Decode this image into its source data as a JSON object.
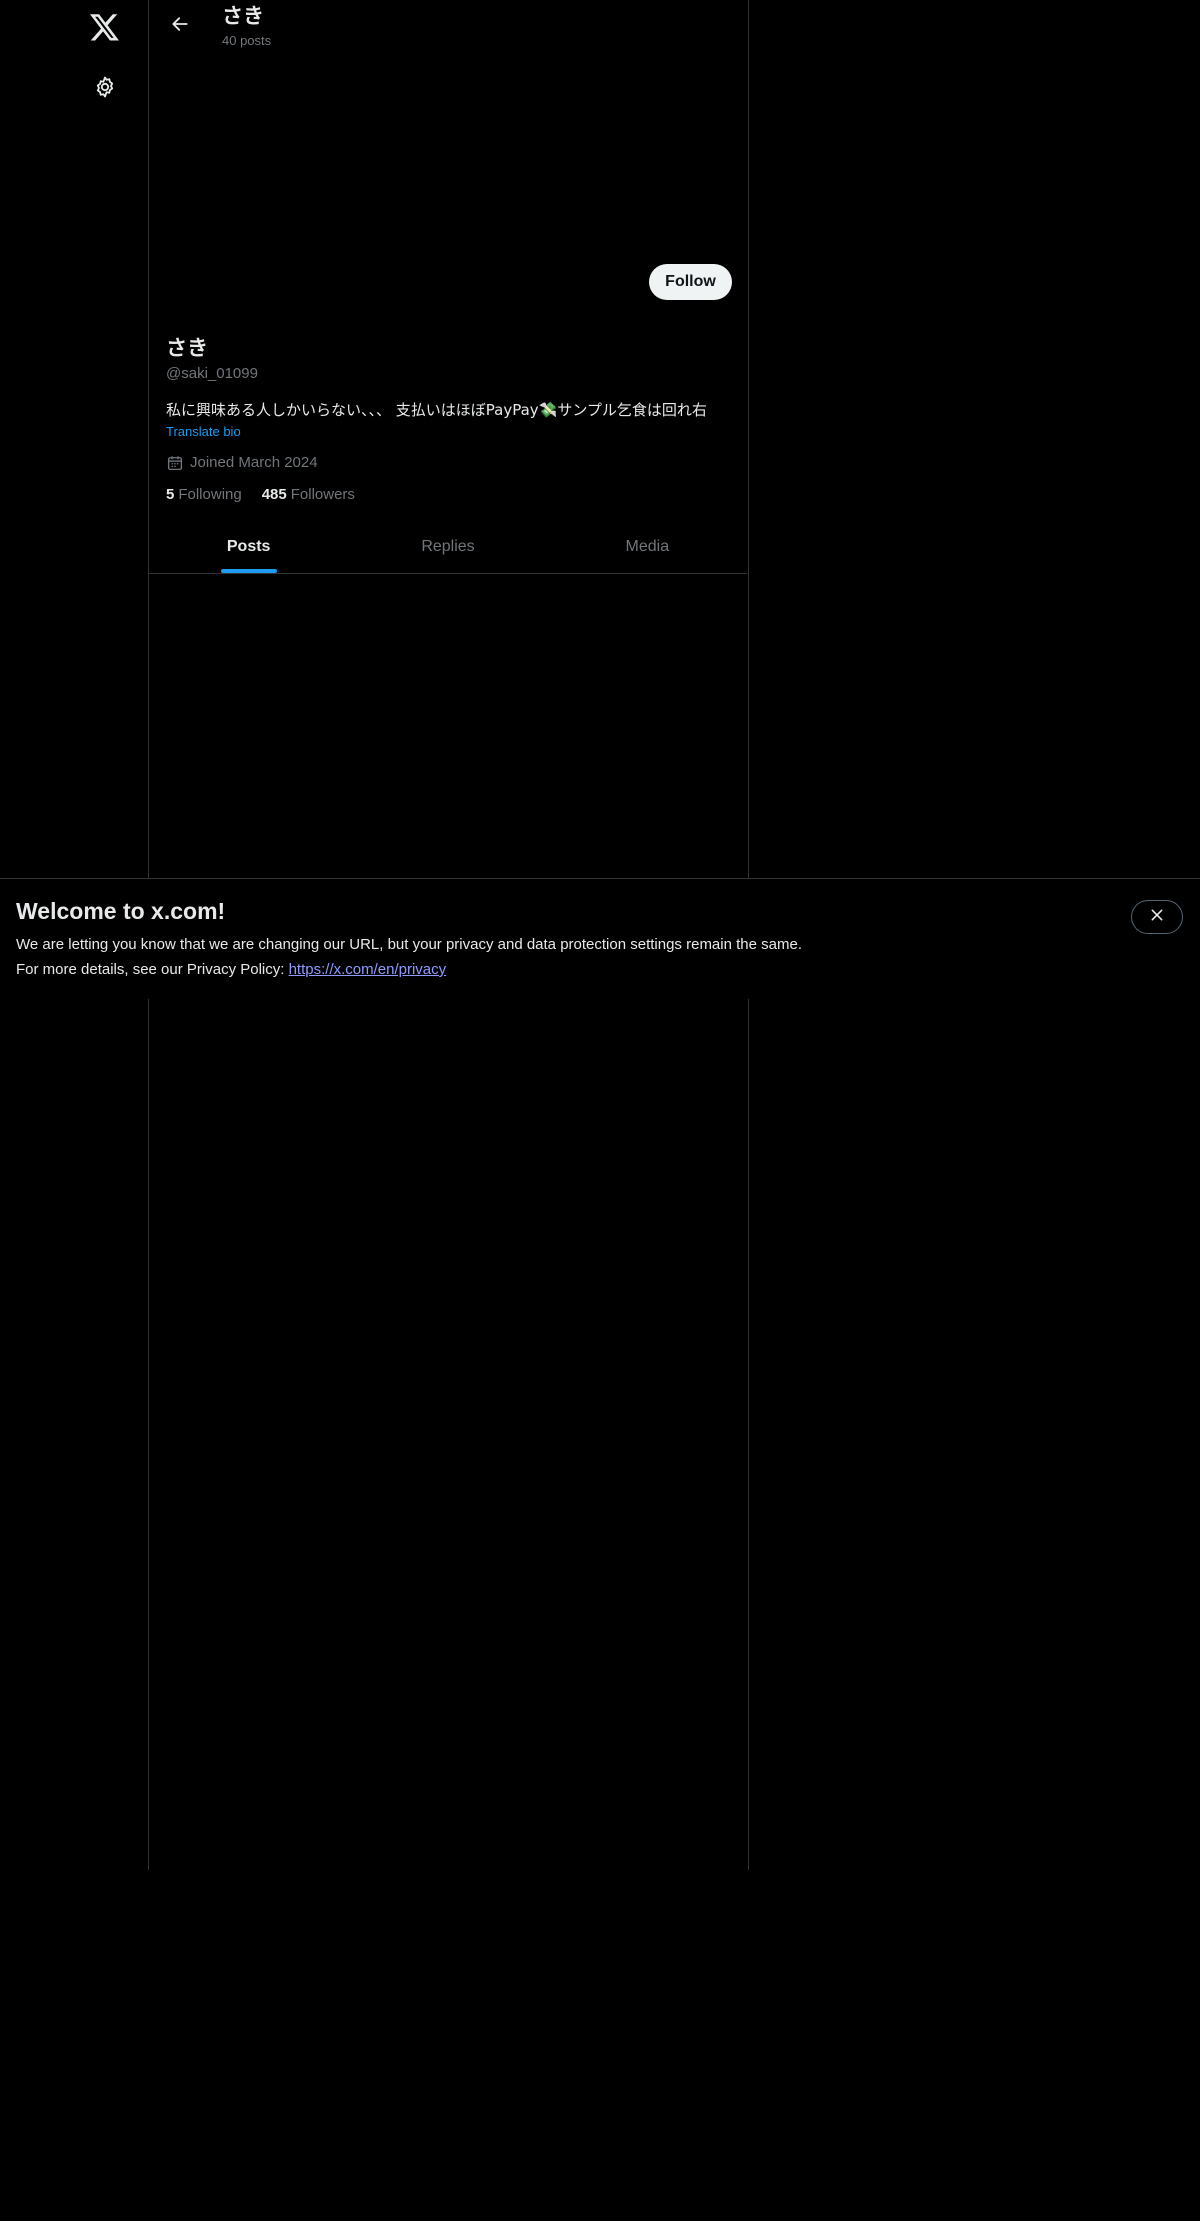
{
  "header": {
    "title": "さき",
    "post_count": "40 posts"
  },
  "profile": {
    "follow_label": "Follow",
    "name": "さき",
    "handle": "@saki_01099",
    "bio": "私に興味ある人しかいらない、、、 支払いはほぼPayPay💸サンプル乞食は回れ右",
    "translate_label": "Translate bio",
    "joined": "Joined March 2024",
    "following_count": "5",
    "following_label": "Following",
    "followers_count": "485",
    "followers_label": "Followers"
  },
  "tabs": [
    {
      "label": "Posts",
      "active": true
    },
    {
      "label": "Replies",
      "active": false
    },
    {
      "label": "Media",
      "active": false
    }
  ],
  "banner": {
    "title": "Welcome to x.com!",
    "line1": "We are letting you know that we are changing our URL, but your privacy and data protection settings remain the same.",
    "line2_prefix": "For more details, see our Privacy Policy: ",
    "privacy_link": "https://x.com/en/privacy"
  },
  "icons": {
    "logo": "x-logo-icon",
    "settings": "gear-icon",
    "back": "arrow-left-icon",
    "calendar": "calendar-icon",
    "close": "close-icon"
  },
  "colors": {
    "background": "#000000",
    "text": "#e7e9ea",
    "muted": "#71767b",
    "accent": "#1d9bf0",
    "border": "#2f3336",
    "link": "#8e9bff"
  }
}
